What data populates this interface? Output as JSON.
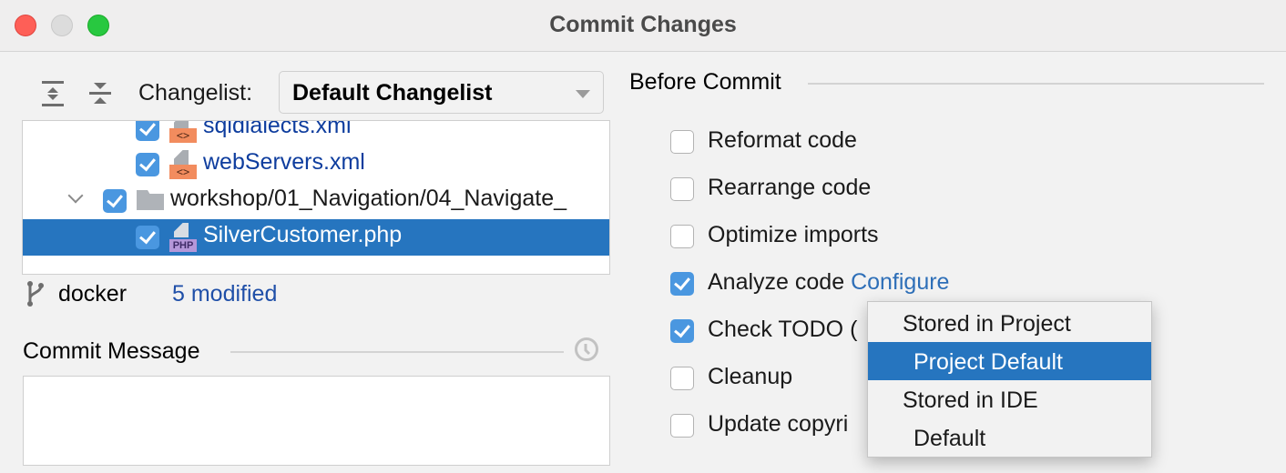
{
  "window": {
    "title": "Commit Changes"
  },
  "toolbar": {
    "expand_all_icon": "expand-all-icon",
    "collapse_all_icon": "collapse-all-icon",
    "changelist_label": "Changelist:",
    "changelist_value": "Default Changelist"
  },
  "tree": {
    "rows": [
      {
        "type": "file",
        "name": "sqldialects.xml",
        "icon": "xml-file-icon",
        "badge": "<>",
        "checked": true,
        "selected": false
      },
      {
        "type": "file",
        "name": "webServers.xml",
        "icon": "xml-file-icon",
        "badge": "<>",
        "checked": true,
        "selected": false
      },
      {
        "type": "folder",
        "name": "workshop/01_Navigation/04_Navigate_",
        "icon": "folder-icon",
        "checked": true,
        "expanded": true,
        "selected": false
      },
      {
        "type": "file",
        "name": "SilverCustomer.php",
        "icon": "php-file-icon",
        "badge": "PHP",
        "checked": true,
        "selected": true
      }
    ]
  },
  "status": {
    "branch_icon": "git-branch-icon",
    "branch": "docker",
    "modified": "5 modified"
  },
  "commit_message": {
    "label": "Commit Message",
    "history_icon": "clock-icon",
    "value": "",
    "placeholder": ""
  },
  "before_commit": {
    "label": "Before Commit",
    "options": [
      {
        "label": "Reformat code",
        "checked": false
      },
      {
        "label": "Rearrange code",
        "checked": false
      },
      {
        "label": "Optimize imports",
        "checked": false
      },
      {
        "label": "Analyze code",
        "link": "Configure",
        "checked": true
      },
      {
        "label": "Check TODO (",
        "checked": true
      },
      {
        "label": "Cleanup",
        "checked": false
      },
      {
        "label": "Update copyri",
        "checked": false
      }
    ]
  },
  "popup": {
    "items": [
      {
        "label": "Stored in Project",
        "indent": false,
        "selected": false
      },
      {
        "label": "Project Default",
        "indent": true,
        "selected": true
      },
      {
        "label": "Stored in IDE",
        "indent": false,
        "selected": false
      },
      {
        "label": "Default",
        "indent": true,
        "selected": false
      }
    ]
  },
  "colors": {
    "selection": "#2675bf",
    "checkbox": "#4a97e0",
    "link": "#2e6fb8",
    "file_name": "#0e3d9e"
  }
}
